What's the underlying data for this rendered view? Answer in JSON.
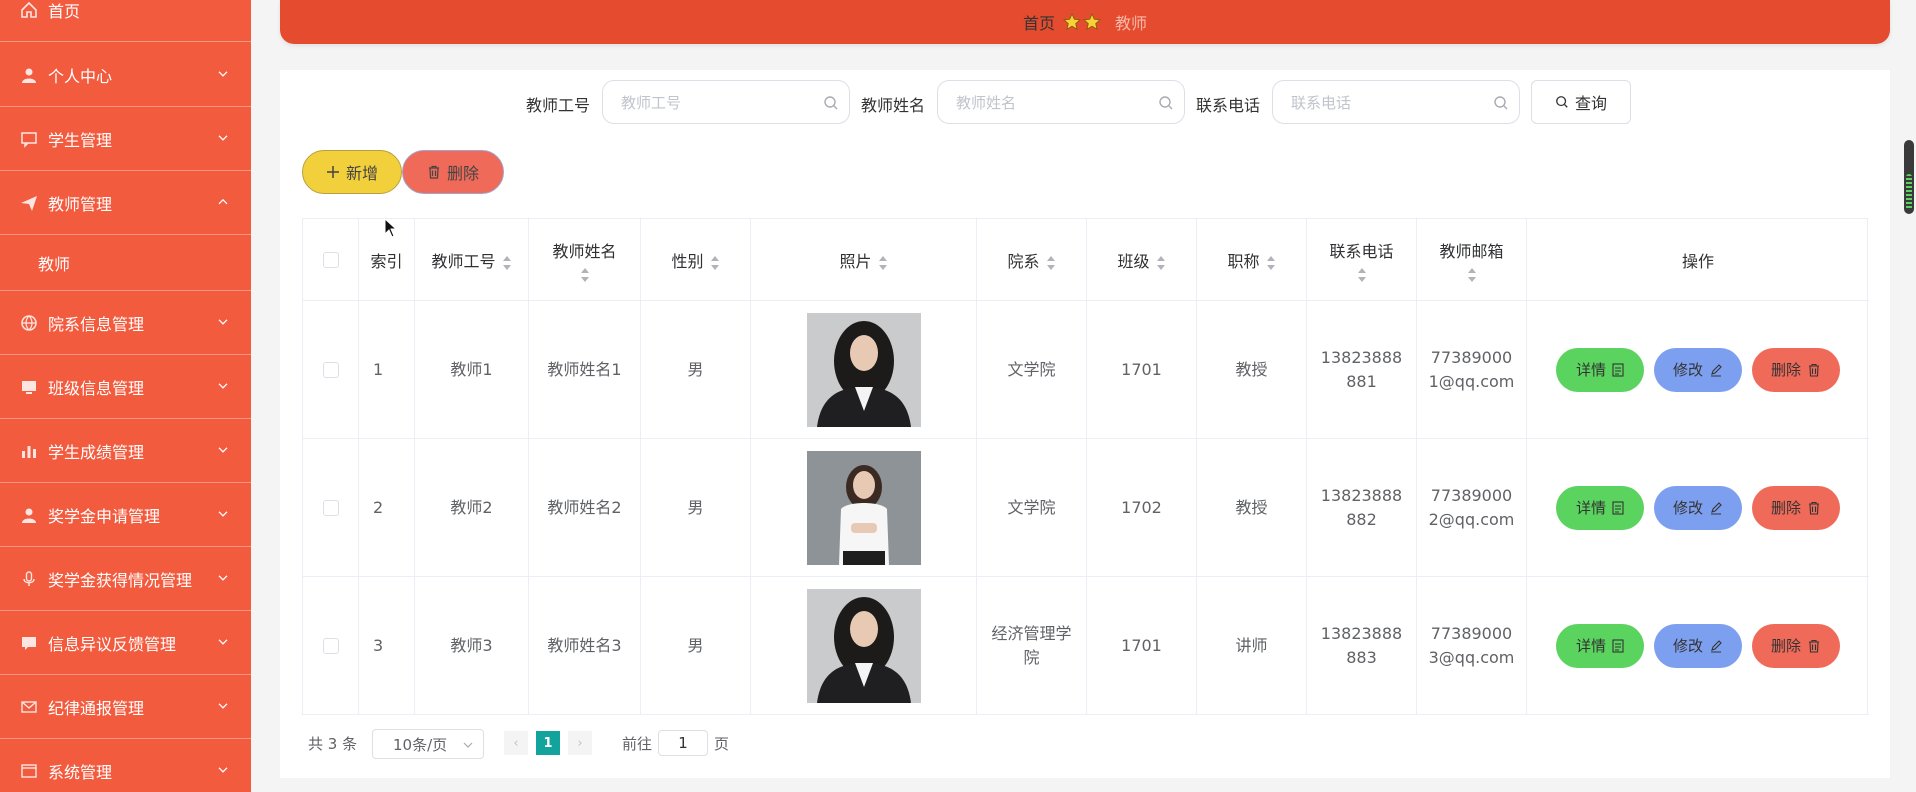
{
  "sidebar": {
    "items": [
      {
        "label": "首页",
        "icon": "home-icon",
        "has_arrow": false
      },
      {
        "label": "个人中心",
        "icon": "user-icon",
        "has_arrow": true
      },
      {
        "label": "学生管理",
        "icon": "chat-icon",
        "has_arrow": true
      },
      {
        "label": "教师管理",
        "icon": "send-icon",
        "has_arrow": true,
        "expanded": true
      },
      {
        "label": "院系信息管理",
        "icon": "globe-icon",
        "has_arrow": true
      },
      {
        "label": "班级信息管理",
        "icon": "monitor-icon",
        "has_arrow": true
      },
      {
        "label": "学生成绩管理",
        "icon": "bar-chart-icon",
        "has_arrow": true
      },
      {
        "label": "奖学金申请管理",
        "icon": "user-icon",
        "has_arrow": true
      },
      {
        "label": "奖学金获得情况管理",
        "icon": "mic-icon",
        "has_arrow": true
      },
      {
        "label": "信息异议反馈管理",
        "icon": "message-icon",
        "has_arrow": true
      },
      {
        "label": "纪律通报管理",
        "icon": "mail-icon",
        "has_arrow": true
      },
      {
        "label": "系统管理",
        "icon": "window-icon",
        "has_arrow": true
      }
    ],
    "submenu": {
      "label": "教师"
    }
  },
  "breadcrumb": {
    "home": "首页",
    "current": "教师"
  },
  "search": {
    "fields": [
      {
        "label": "教师工号",
        "placeholder": "教师工号"
      },
      {
        "label": "教师姓名",
        "placeholder": "教师姓名"
      },
      {
        "label": "联系电话",
        "placeholder": "联系电话"
      }
    ],
    "query_label": "查询"
  },
  "actions": {
    "add_label": "新增",
    "delete_label": "删除"
  },
  "table": {
    "headers": {
      "index": "索引",
      "teacher_id": "教师工号",
      "teacher_name": "教师姓名",
      "gender": "性别",
      "photo": "照片",
      "department": "院系",
      "class": "班级",
      "title": "职称",
      "phone": "联系电话",
      "email": "教师邮箱",
      "operations": "操作"
    },
    "rows": [
      {
        "index": "1",
        "teacher_id": "教师1",
        "teacher_name": "教师姓名1",
        "gender": "男",
        "department": "文学院",
        "class": "1701",
        "title": "教授",
        "phone": "13823888881",
        "email": "773890001@qq.com",
        "photo_style": "dark-suit"
      },
      {
        "index": "2",
        "teacher_id": "教师2",
        "teacher_name": "教师姓名2",
        "gender": "男",
        "department": "文学院",
        "class": "1702",
        "title": "教授",
        "phone": "13823888882",
        "email": "773890002@qq.com",
        "photo_style": "white-shirt"
      },
      {
        "index": "3",
        "teacher_id": "教师3",
        "teacher_name": "教师姓名3",
        "gender": "男",
        "department": "经济管理学院",
        "class": "1701",
        "title": "讲师",
        "phone": "13823888883",
        "email": "773890003@qq.com",
        "photo_style": "dark-suit"
      }
    ],
    "row_actions": {
      "detail": "详情",
      "edit": "修改",
      "delete": "删除"
    }
  },
  "pagination": {
    "total": "共 3 条",
    "page_size": "10条/页",
    "current_page": "1",
    "goto_label": "前往",
    "goto_value": "1",
    "page_suffix": "页"
  },
  "colors": {
    "sidebar": "#f35b3f",
    "topbar": "#e54c2f",
    "add": "#f2d03b",
    "delete": "#f06a5a",
    "detail": "#5ad35f",
    "edit": "#7d9ff0",
    "active_page": "#11a39c"
  }
}
